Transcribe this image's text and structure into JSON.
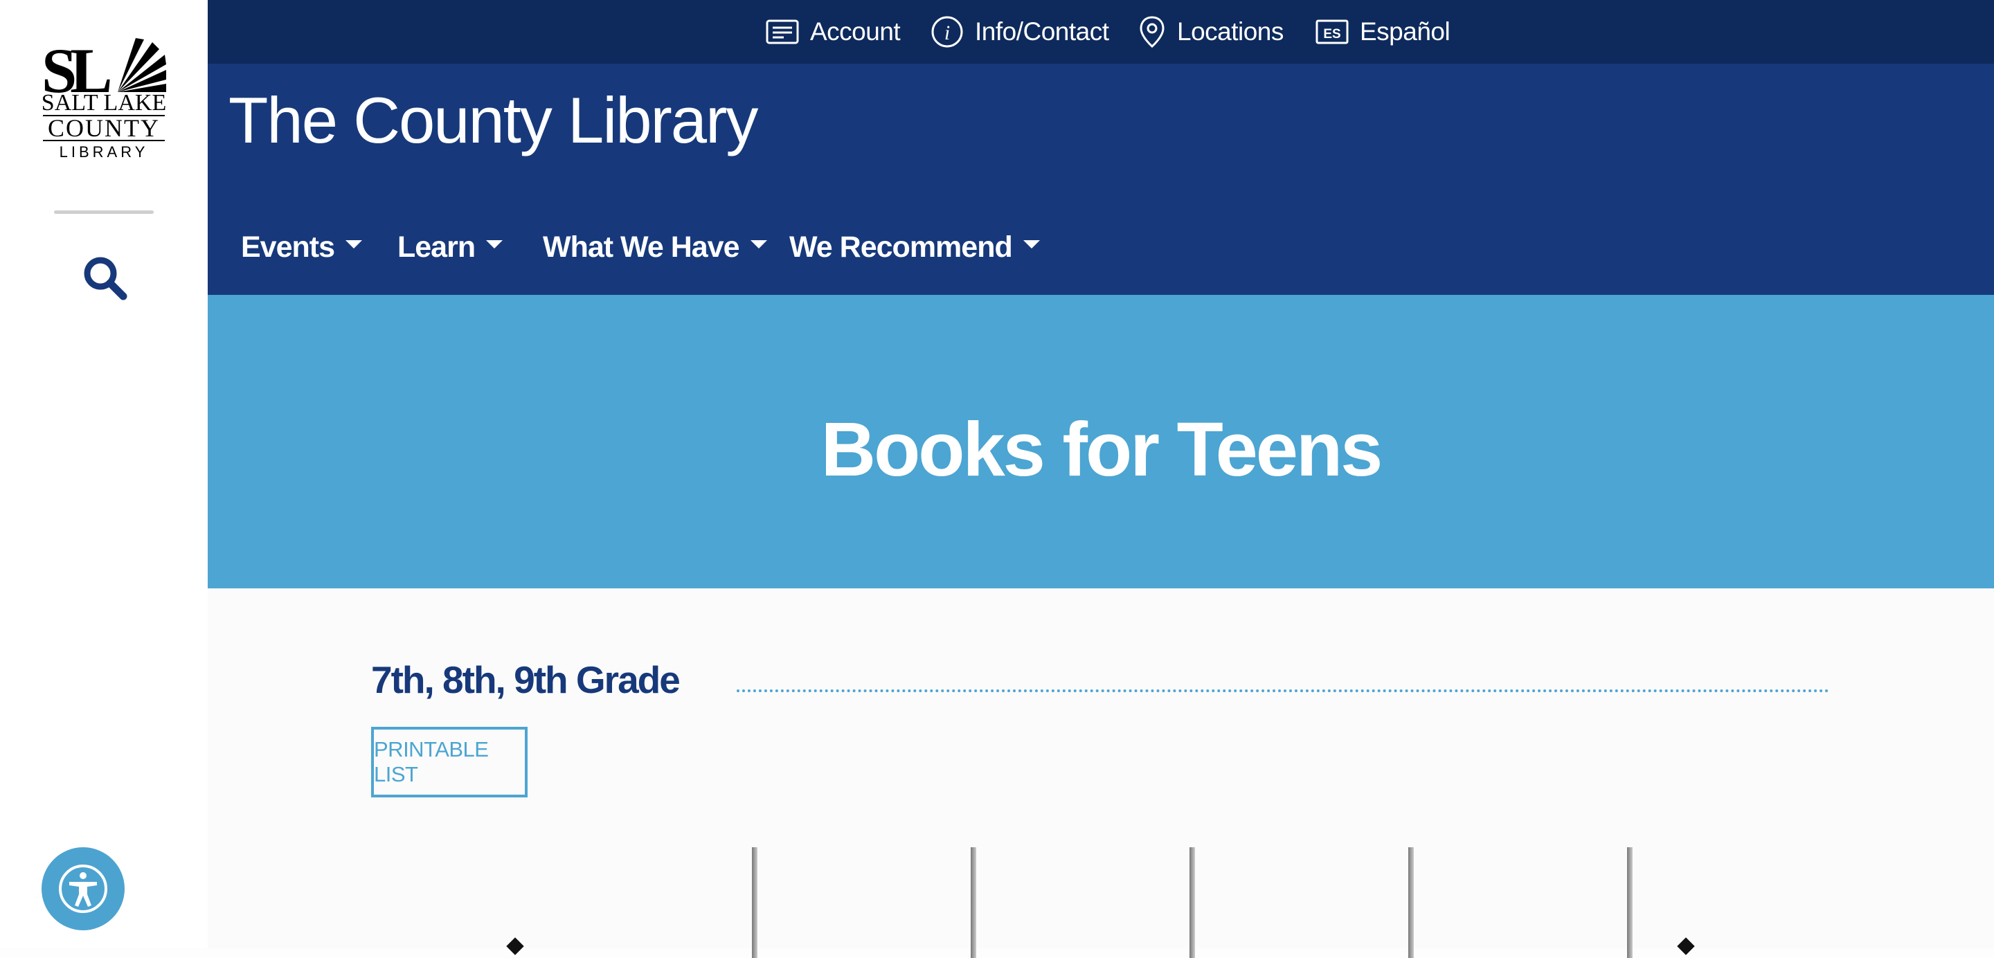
{
  "logo": {
    "line1": "SALT LAKE",
    "line2": "COUNTY",
    "line3": "LIBRARY"
  },
  "utility_nav": [
    {
      "label": "Account",
      "icon": "account-card-icon"
    },
    {
      "label": "Info/Contact",
      "icon": "info-circle-icon"
    },
    {
      "label": "Locations",
      "icon": "map-pin-icon"
    },
    {
      "label": "Español",
      "icon": "es-badge-icon",
      "badge": "ES"
    }
  ],
  "header": {
    "site_title": "The County Library"
  },
  "main_nav": [
    {
      "label": "Events"
    },
    {
      "label": "Learn"
    },
    {
      "label": "What We Have"
    },
    {
      "label": "We Recommend"
    }
  ],
  "hero": {
    "title": "Books for Teens"
  },
  "section": {
    "heading": "7th, 8th, 9th Grade",
    "printable_label": "PRINTABLE LIST"
  },
  "colors": {
    "utility_bar": "#0e2a5c",
    "header": "#17397b",
    "hero": "#4ca5d2",
    "accent": "#4ca5d2",
    "heading_text": "#17397b"
  }
}
